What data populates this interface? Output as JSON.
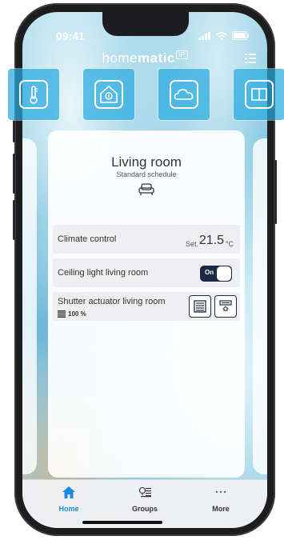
{
  "status": {
    "time": "09:41"
  },
  "header": {
    "logo_regular": "home",
    "logo_bold": "matic",
    "logo_badge": "IP"
  },
  "quickbar": {
    "tiles": [
      {
        "icon": "thermometer-icon"
      },
      {
        "icon": "house-info-icon"
      },
      {
        "icon": "cloud-icon"
      },
      {
        "icon": "window-icon"
      }
    ]
  },
  "room": {
    "title": "Living room",
    "subtitle": "Standard schedule",
    "icon": "sofa-icon"
  },
  "climate": {
    "label": "Climate control",
    "set_label": "Set.",
    "value": "21.5",
    "unit": "°C"
  },
  "light": {
    "label": "Ceiling light living room",
    "toggle_text": "On",
    "state": "on"
  },
  "shutter": {
    "label": "Shutter actuator living room",
    "level": "100 %"
  },
  "tabs": [
    {
      "label": "Home",
      "icon": "home-icon",
      "active": true
    },
    {
      "label": "Groups",
      "icon": "groups-icon",
      "active": false
    },
    {
      "label": "More",
      "icon": "more-icon",
      "active": false
    }
  ],
  "colors": {
    "accent": "#1a8be0",
    "dark": "#1a2a44",
    "tile": "#28aae1"
  }
}
